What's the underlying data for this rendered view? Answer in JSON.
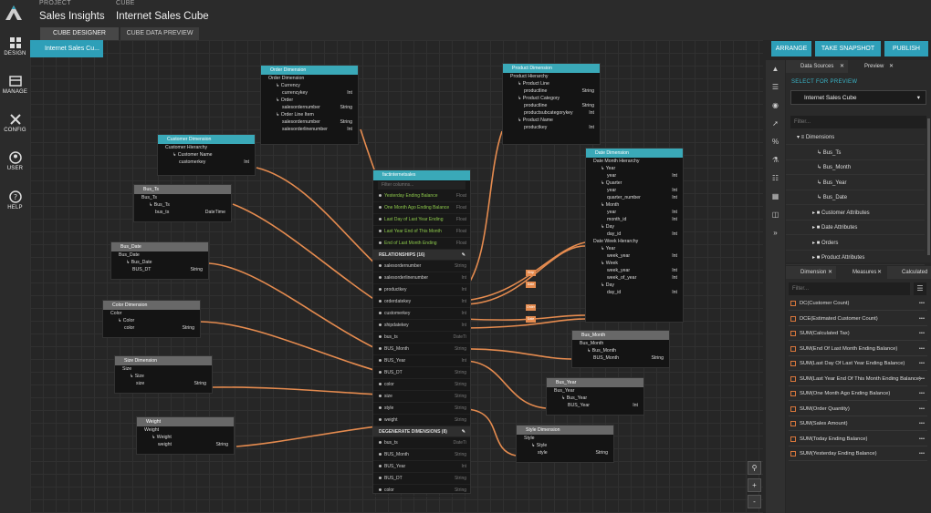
{
  "header": {
    "project_caption": "PROJECT",
    "project_name": "Sales Insights",
    "cube_caption": "CUBE",
    "cube_name": "Internet Sales Cube",
    "tabs": [
      "CUBE DESIGNER",
      "CUBE DATA PREVIEW"
    ]
  },
  "sidebar": {
    "items": [
      {
        "label": "DESIGN",
        "icon": "design-icon"
      },
      {
        "label": "MANAGE",
        "icon": "manage-icon"
      },
      {
        "label": "CONFIG",
        "icon": "config-icon"
      },
      {
        "label": "USER",
        "icon": "user-icon"
      },
      {
        "label": "HELP",
        "icon": "help-icon"
      }
    ]
  },
  "canvas": {
    "cube_tab": "Internet Sales Cu..."
  },
  "actions": {
    "arrange": "ARRANGE",
    "snapshot": "TAKE SNAPSHOT",
    "publish": "PUBLISH"
  },
  "dimensions": {
    "order": {
      "title": "Order Dimension",
      "hier": "Order Dimension",
      "rows": [
        [
          "Currency",
          ""
        ],
        [
          "currencykey",
          "Int"
        ],
        [
          "Order",
          ""
        ],
        [
          "salesordernumber",
          "String"
        ],
        [
          "Order Line Item",
          ""
        ],
        [
          "salesordernumber",
          "String"
        ],
        [
          "salesorderlinenumber",
          "Int"
        ]
      ]
    },
    "product": {
      "title": "Product Dimension",
      "hier": "Product Hierarchy",
      "rows": [
        [
          "Product Line",
          ""
        ],
        [
          "productline",
          "String"
        ],
        [
          "Product Category",
          ""
        ],
        [
          "productline",
          "String"
        ],
        [
          "productsubcategorykey",
          "Int"
        ],
        [
          "Product Name",
          ""
        ],
        [
          "productkey",
          "Int"
        ]
      ]
    },
    "customer": {
      "title": "Customer Dimension",
      "hier": "Customer Hierarchy",
      "rows": [
        [
          "Customer Name",
          ""
        ],
        [
          "customerkey",
          "Int"
        ]
      ]
    },
    "bus_ts": {
      "title": "Bus_Ts",
      "hier": "Bus_Ts",
      "rows": [
        [
          "Bus_Ts",
          ""
        ],
        [
          "bus_ts",
          "DateTime"
        ]
      ]
    },
    "bus_date": {
      "title": "Bus_Date",
      "hier": "Bus_Date",
      "rows": [
        [
          "Bus_Date",
          ""
        ],
        [
          "BUS_DT",
          "String"
        ]
      ]
    },
    "color": {
      "title": "Color Dimension",
      "hier": "Color",
      "rows": [
        [
          "Color",
          ""
        ],
        [
          "color",
          "String"
        ]
      ]
    },
    "size": {
      "title": "Size Dimension",
      "hier": "Size",
      "rows": [
        [
          "Size",
          ""
        ],
        [
          "size",
          "String"
        ]
      ]
    },
    "weight": {
      "title": "Weight",
      "hier": "Weight",
      "rows": [
        [
          "Weight",
          ""
        ],
        [
          "weight",
          "String"
        ]
      ]
    },
    "date": {
      "title": "Date Dimension",
      "hier": "Date Month Hierarchy",
      "rows": [
        [
          "Year",
          ""
        ],
        [
          "year",
          "Int"
        ],
        [
          "Quarter",
          ""
        ],
        [
          "year",
          "Int"
        ],
        [
          "quarter_number",
          "Int"
        ],
        [
          "Month",
          ""
        ],
        [
          "year",
          "Int"
        ],
        [
          "month_id",
          "Int"
        ],
        [
          "Day",
          ""
        ],
        [
          "day_id",
          "Int"
        ]
      ],
      "hier2": "Date Week Hierarchy",
      "rows2": [
        [
          "Year",
          ""
        ],
        [
          "week_year",
          "Int"
        ],
        [
          "Week",
          ""
        ],
        [
          "week_year",
          "Int"
        ],
        [
          "week_of_year",
          "Int"
        ],
        [
          "Day",
          ""
        ],
        [
          "day_id",
          "Int"
        ]
      ]
    },
    "bus_month": {
      "title": "Bus_Month",
      "hier": "Bus_Month",
      "rows": [
        [
          "Bus_Month",
          ""
        ],
        [
          "BUS_Month",
          "String"
        ]
      ]
    },
    "bus_year": {
      "title": "Bus_Year",
      "hier": "Bus_Year",
      "rows": [
        [
          "Bus_Year",
          ""
        ],
        [
          "BUS_Year",
          "Int"
        ]
      ]
    },
    "style": {
      "title": "Style Dimension",
      "hier": "Style",
      "rows": [
        [
          "Style",
          ""
        ],
        [
          "style",
          "String"
        ]
      ]
    }
  },
  "fact": {
    "title": "factinternetsales",
    "filter_placeholder": "Filter columns...",
    "measures": [
      [
        "Yesterday Ending Balance",
        "Float"
      ],
      [
        "One Month Ago Ending Balance",
        "Float"
      ],
      [
        "Last Day of Last Year Ending",
        "Float"
      ],
      [
        "Last Year End of This Month",
        "Float"
      ],
      [
        "End of Last Month Ending",
        "Float"
      ]
    ],
    "relationships_title": "RELATIONSHIPS (16)",
    "relationships": [
      [
        "salesordernumber",
        "String"
      ],
      [
        "salesorderlinenumber",
        "Int"
      ],
      [
        "productkey",
        "Int"
      ],
      [
        "orderdatekey",
        "Int"
      ],
      [
        "customerkey",
        "Int"
      ],
      [
        "shipdatekey",
        "Int"
      ],
      [
        "bus_ts",
        "DateTi"
      ],
      [
        "BUS_Month",
        "String"
      ],
      [
        "BUS_Year",
        "Int"
      ],
      [
        "BUS_DT",
        "String"
      ],
      [
        "color",
        "String"
      ],
      [
        "size",
        "String"
      ],
      [
        "style",
        "String"
      ],
      [
        "weight",
        "String"
      ]
    ],
    "degenerate_title": "DEGENERATE DIMENSIONS (8)",
    "degenerate": [
      [
        "bus_ts",
        "DateTi"
      ],
      [
        "BUS_Month",
        "String"
      ],
      [
        "BUS_Year",
        "Int"
      ],
      [
        "BUS_DT",
        "String"
      ],
      [
        "color",
        "String"
      ]
    ]
  },
  "role_labels": [
    "Ship",
    "Date",
    "Order",
    "Date"
  ],
  "zoom": {
    "search": "search-icon",
    "plus": "+",
    "minus": "-"
  },
  "right_panel": {
    "tabs": [
      "Data Sources",
      "Preview"
    ],
    "select_label": "SELECT FOR PREVIEW",
    "selected_cube": "Internet Sales Cube",
    "filter_placeholder": "Filter...",
    "tree": [
      {
        "label": "Dimensions",
        "level": 0
      },
      {
        "label": "Bus_Ts",
        "level": 1
      },
      {
        "label": "Bus_Month",
        "level": 1
      },
      {
        "label": "Bus_Year",
        "level": 1
      },
      {
        "label": "Bus_Date",
        "level": 1
      },
      {
        "label": "Customer Attributes",
        "level": 2
      },
      {
        "label": "Date Attributes",
        "level": 2
      },
      {
        "label": "Orders",
        "level": 2
      },
      {
        "label": "Product Attributes",
        "level": 2
      }
    ],
    "bottom_tabs": [
      "Dimension",
      "Measures",
      "Calculated"
    ],
    "measures_filter": "Filter...",
    "measures": [
      "DC(Customer Count)",
      "DCE(Estimated Customer Count)",
      "SUM(Calculated Tax)",
      "SUM(End Of Last Month Ending Balance)",
      "SUM(Last Day Of Last Year Ending Balance)",
      "SUM(Last Year End Of This Month Ending Balance)",
      "SUM(One Month Ago Ending Balance)",
      "SUM(Order Quantity)",
      "SUM(Sales Amount)",
      "SUM(Today Ending Balance)",
      "SUM(Yesterday Ending Balance)"
    ]
  },
  "colors": {
    "accent": "#2e9fb8",
    "wire": "#e58b4f",
    "canvas": "#262626"
  }
}
